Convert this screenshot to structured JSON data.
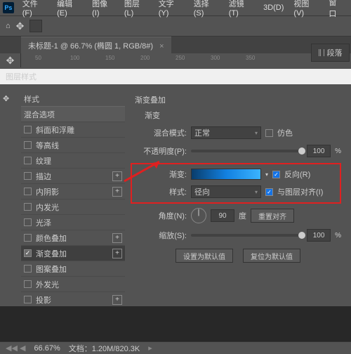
{
  "menubar": {
    "items": [
      "文件(F)",
      "编辑(E)",
      "图像(I)",
      "图层(L)",
      "文字(Y)",
      "选择(S)",
      "滤镜(T)",
      "3D(D)",
      "视图(V)",
      "窗口"
    ]
  },
  "tab": {
    "title": "未标题-1 @ 66.7% (椭圆 1, RGB/8#)"
  },
  "ruler": {
    "marks": [
      "50",
      "100",
      "150",
      "200",
      "250",
      "300",
      "350"
    ]
  },
  "right_panel": {
    "label": "段落"
  },
  "dialog": {
    "title": "图层样式"
  },
  "styles": {
    "header": "样式",
    "blend_section": "混合选项",
    "rows": [
      {
        "label": "斜面和浮雕",
        "checked": false,
        "plus": false
      },
      {
        "label": "等高线",
        "checked": false,
        "plus": false
      },
      {
        "label": "纹理",
        "checked": false,
        "plus": false
      },
      {
        "label": "描边",
        "checked": false,
        "plus": true
      },
      {
        "label": "内阴影",
        "checked": false,
        "plus": true
      },
      {
        "label": "内发光",
        "checked": false,
        "plus": false
      },
      {
        "label": "光泽",
        "checked": false,
        "plus": false
      },
      {
        "label": "颜色叠加",
        "checked": false,
        "plus": true
      },
      {
        "label": "渐变叠加",
        "checked": true,
        "plus": true
      },
      {
        "label": "图案叠加",
        "checked": false,
        "plus": false
      },
      {
        "label": "外发光",
        "checked": false,
        "plus": false
      },
      {
        "label": "投影",
        "checked": false,
        "plus": true
      }
    ]
  },
  "gradient": {
    "title": "渐变叠加",
    "subtitle": "渐变",
    "blend_mode_label": "混合模式:",
    "blend_mode_value": "正常",
    "dither_label": "仿色",
    "opacity_label": "不透明度(P):",
    "opacity_value": "100",
    "pct": "%",
    "gradient_label": "渐变:",
    "reverse_label": "反向(R)",
    "style_label": "样式:",
    "style_value": "径向",
    "align_label": "与图层对齐(I)",
    "angle_label": "角度(N):",
    "angle_value": "90",
    "angle_unit": "度",
    "reset_align": "重置对齐",
    "scale_label": "缩放(S):",
    "scale_value": "100",
    "set_default": "设置为默认值",
    "reset_default": "复位为默认值"
  },
  "status": {
    "zoom": "66.67%",
    "doc": "文档：1.20M/820.3K"
  }
}
